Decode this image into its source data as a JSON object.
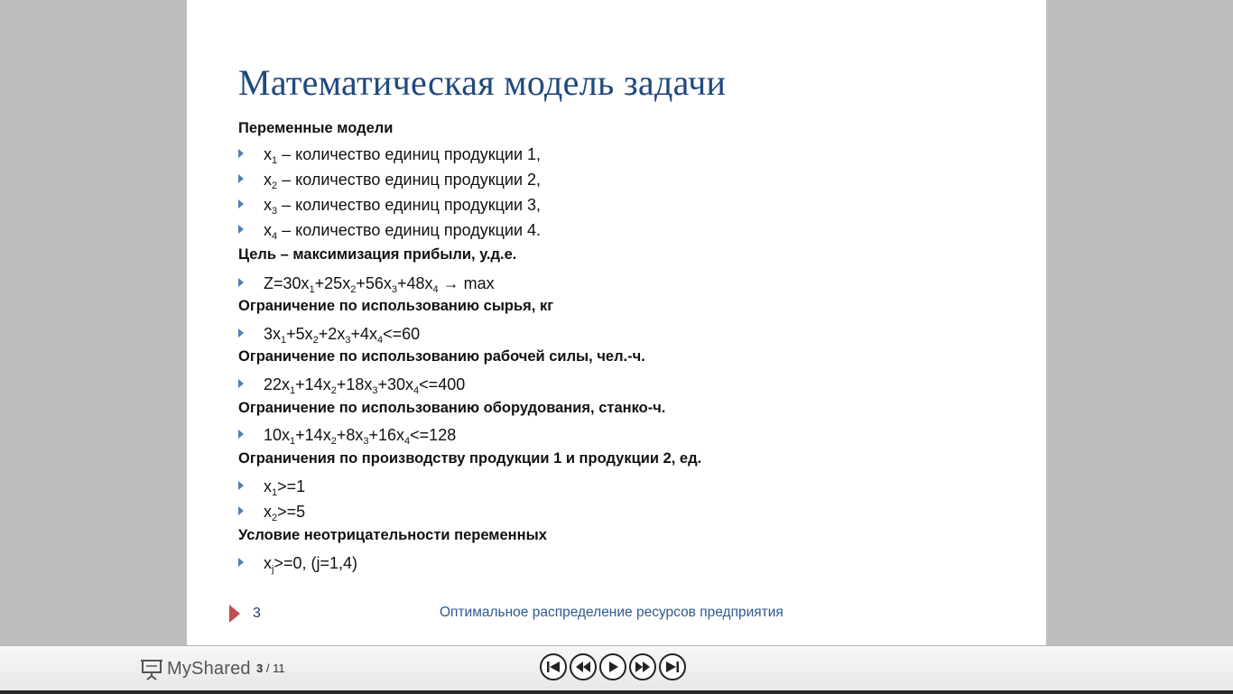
{
  "slide": {
    "title": "Математическая модель задачи",
    "headings": {
      "variables": "Переменные модели",
      "goal": "Цель – максимизация прибыли, у.д.е.",
      "raw": "Ограничение по использованию сырья, кг",
      "labor": "Ограничение по использованию рабочей силы, чел.-ч.",
      "equipment": "Ограничение по использованию оборудования, станко-ч.",
      "production": "Ограничения по производству продукции 1 и продукции 2, ед.",
      "nonneg": "Условие неотрицательности переменных"
    },
    "bullets": {
      "x1_var": "x1 – количество единиц продукции 1,",
      "x2_var": "x2 – количество единиц продукции 2,",
      "x3_var": "x3 – количество единиц продукции 3,",
      "x4_var": "x4 – количество единиц продукции 4.",
      "objective": "Z=30x1+25x2+56x3+48x4 → max",
      "raw_constraint": "3x1+5x2+2x3+4x4<=60",
      "labor_constraint": "22x1+14x2+18x3+30x4<=400",
      "equipment_constraint": "10x1+14x2+8x3+16x4<=128",
      "x1_min": "x1>=1",
      "x2_min": "x2>=5",
      "nonneg_constraint": "xj>=0, (j=1,4)"
    },
    "footer": {
      "number": "3",
      "text": "Оптимальное распределение ресурсов  предприятия"
    }
  },
  "toolbar": {
    "brand": "MyShared",
    "current_page": "3",
    "separator": "/",
    "total_pages": "11"
  },
  "colors": {
    "title": "#1f497d",
    "bullet": "#4f7fb8",
    "footer_arrow": "#c0504d"
  }
}
